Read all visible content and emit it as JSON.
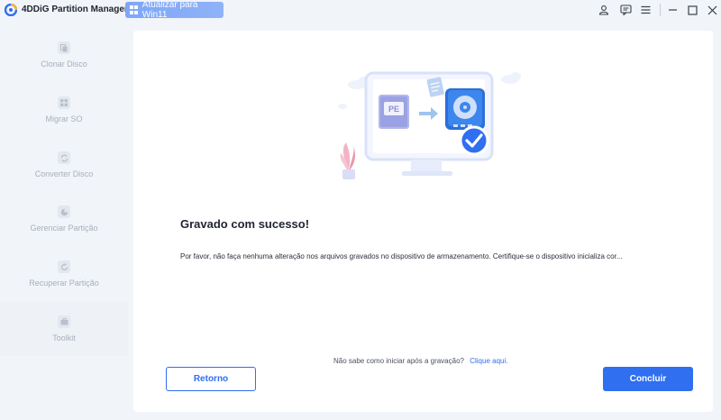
{
  "app": {
    "title": "4DDiG Partition Manager",
    "upgrade_label": "Atualizar para Win11"
  },
  "titlebar_icons": [
    "user-icon",
    "feedback-icon",
    "menu-icon",
    "minimize-icon",
    "maximize-icon",
    "close-icon"
  ],
  "sidebar": {
    "items": [
      {
        "label": "Clonar Disco",
        "icon": "clone-disk-icon"
      },
      {
        "label": "Migrar SO",
        "icon": "migrate-os-icon"
      },
      {
        "label": "Converter Disco",
        "icon": "convert-disk-icon"
      },
      {
        "label": "Gerenciar Partição",
        "icon": "manage-partition-icon"
      },
      {
        "label": "Recuperar Partição",
        "icon": "recover-partition-icon"
      },
      {
        "label": "Toolkit",
        "icon": "toolkit-icon"
      }
    ],
    "active_index": 5
  },
  "main": {
    "illustration_label": "PE",
    "heading": "Gravado com sucesso!",
    "description": "Por favor, não faça nenhuma alteração nos arquivos gravados no dispositivo de armazenamento. Certifique-se o dispositivo inicializa cor...",
    "help_text": "Não sabe como iniciar após a gravação?",
    "help_link": "Clique aqui.",
    "back_label": "Retorno",
    "done_label": "Concluir"
  },
  "colors": {
    "accent": "#2f6ff0",
    "upgrade": "#7fa7f8",
    "background": "#f1f4f8"
  }
}
